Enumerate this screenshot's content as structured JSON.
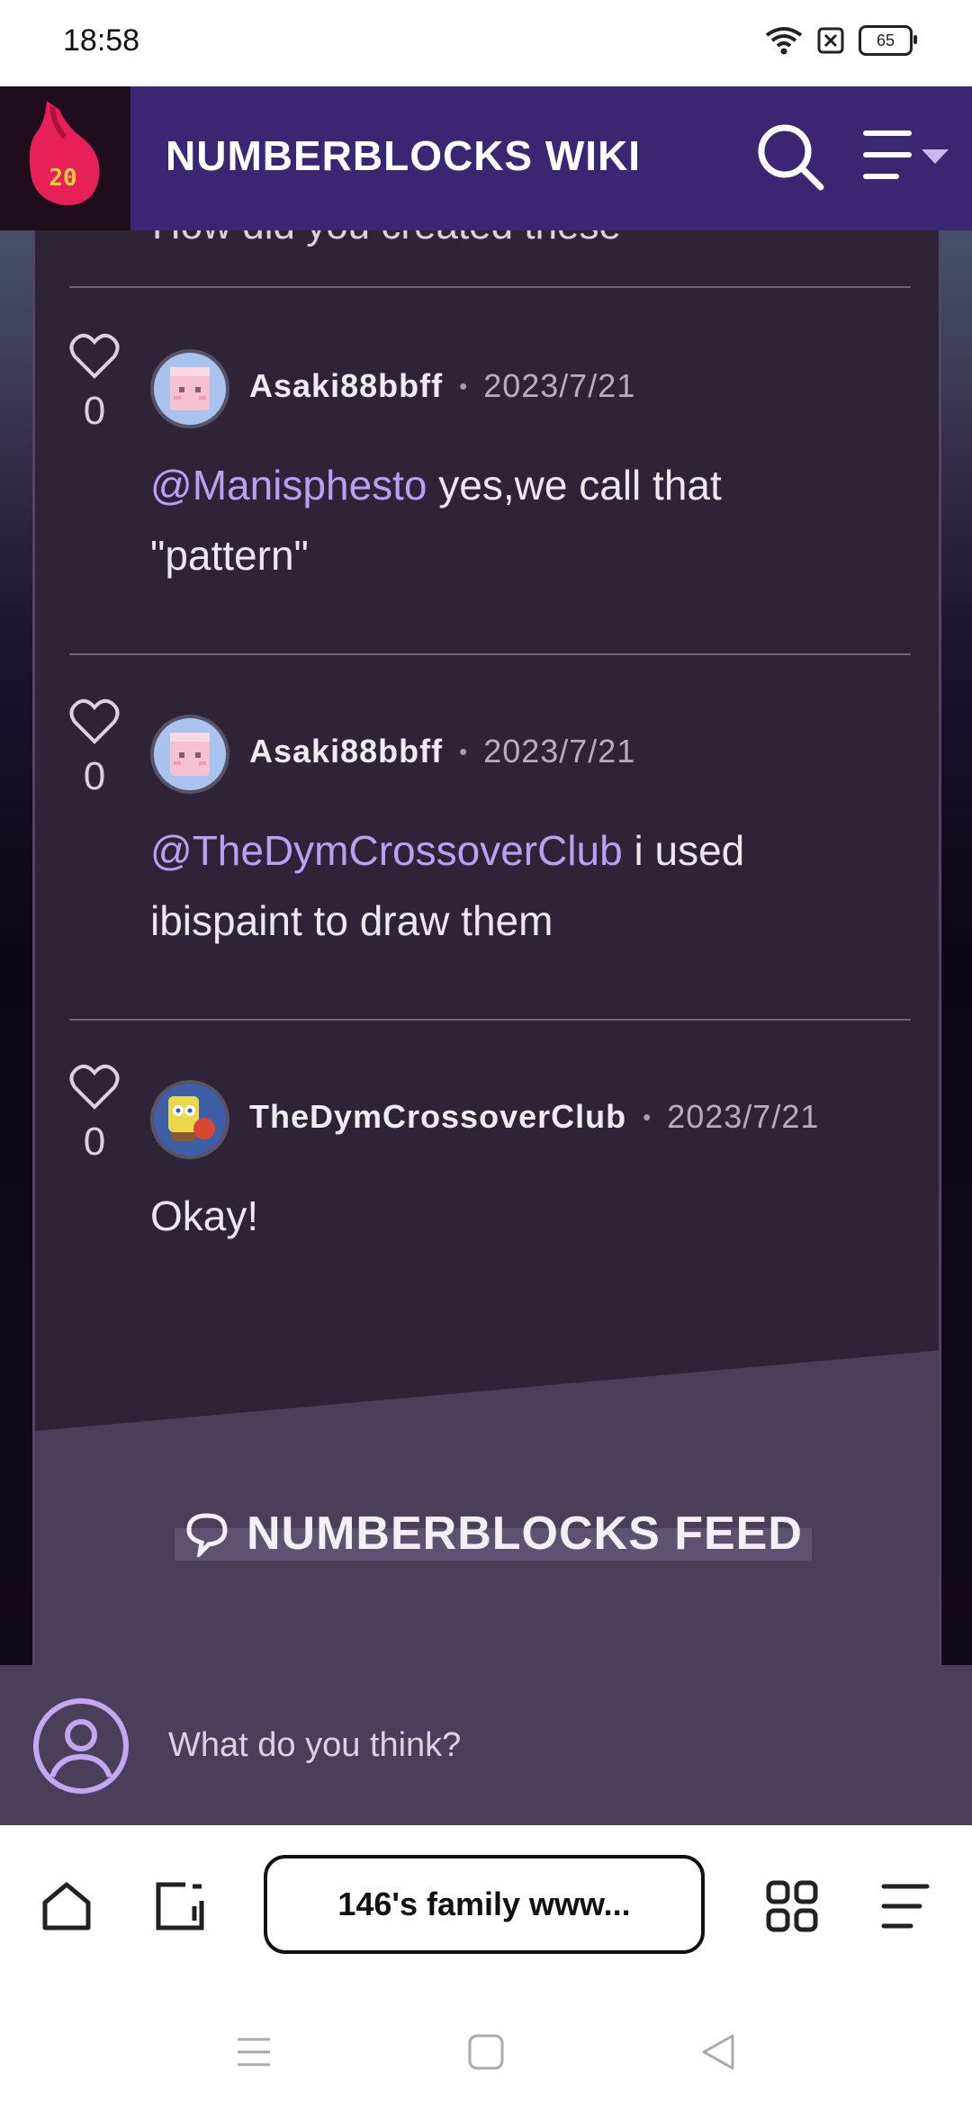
{
  "status_bar": {
    "time": "18:58",
    "battery": "65"
  },
  "wiki": {
    "title": "NUMBERBLOCKS WIKI",
    "logo_text": "20"
  },
  "cut_text": "How did you created these",
  "comments": [
    {
      "likes": "0",
      "author": "Asaki88bbff",
      "date": "2023/7/21",
      "mention": "@Manisphesto",
      "text": " yes,we call that \"pattern\""
    },
    {
      "likes": "0",
      "author": "Asaki88bbff",
      "date": "2023/7/21",
      "mention": "@TheDymCrossoverClub",
      "text": " i used ibispaint to draw them"
    },
    {
      "likes": "0",
      "author": "TheDymCrossoverClub",
      "date": "2023/7/21",
      "mention": "",
      "text": "Okay!"
    }
  ],
  "feed": {
    "title": "NUMBERBLOCKS FEED"
  },
  "comment_input": {
    "placeholder": "What do you think?"
  },
  "browser": {
    "url_label": "146's family www..."
  },
  "colors": {
    "header": "#3a2672",
    "panel": "#2e2438",
    "mention": "#b9a0f0",
    "input_bar": "#4a3f59"
  }
}
